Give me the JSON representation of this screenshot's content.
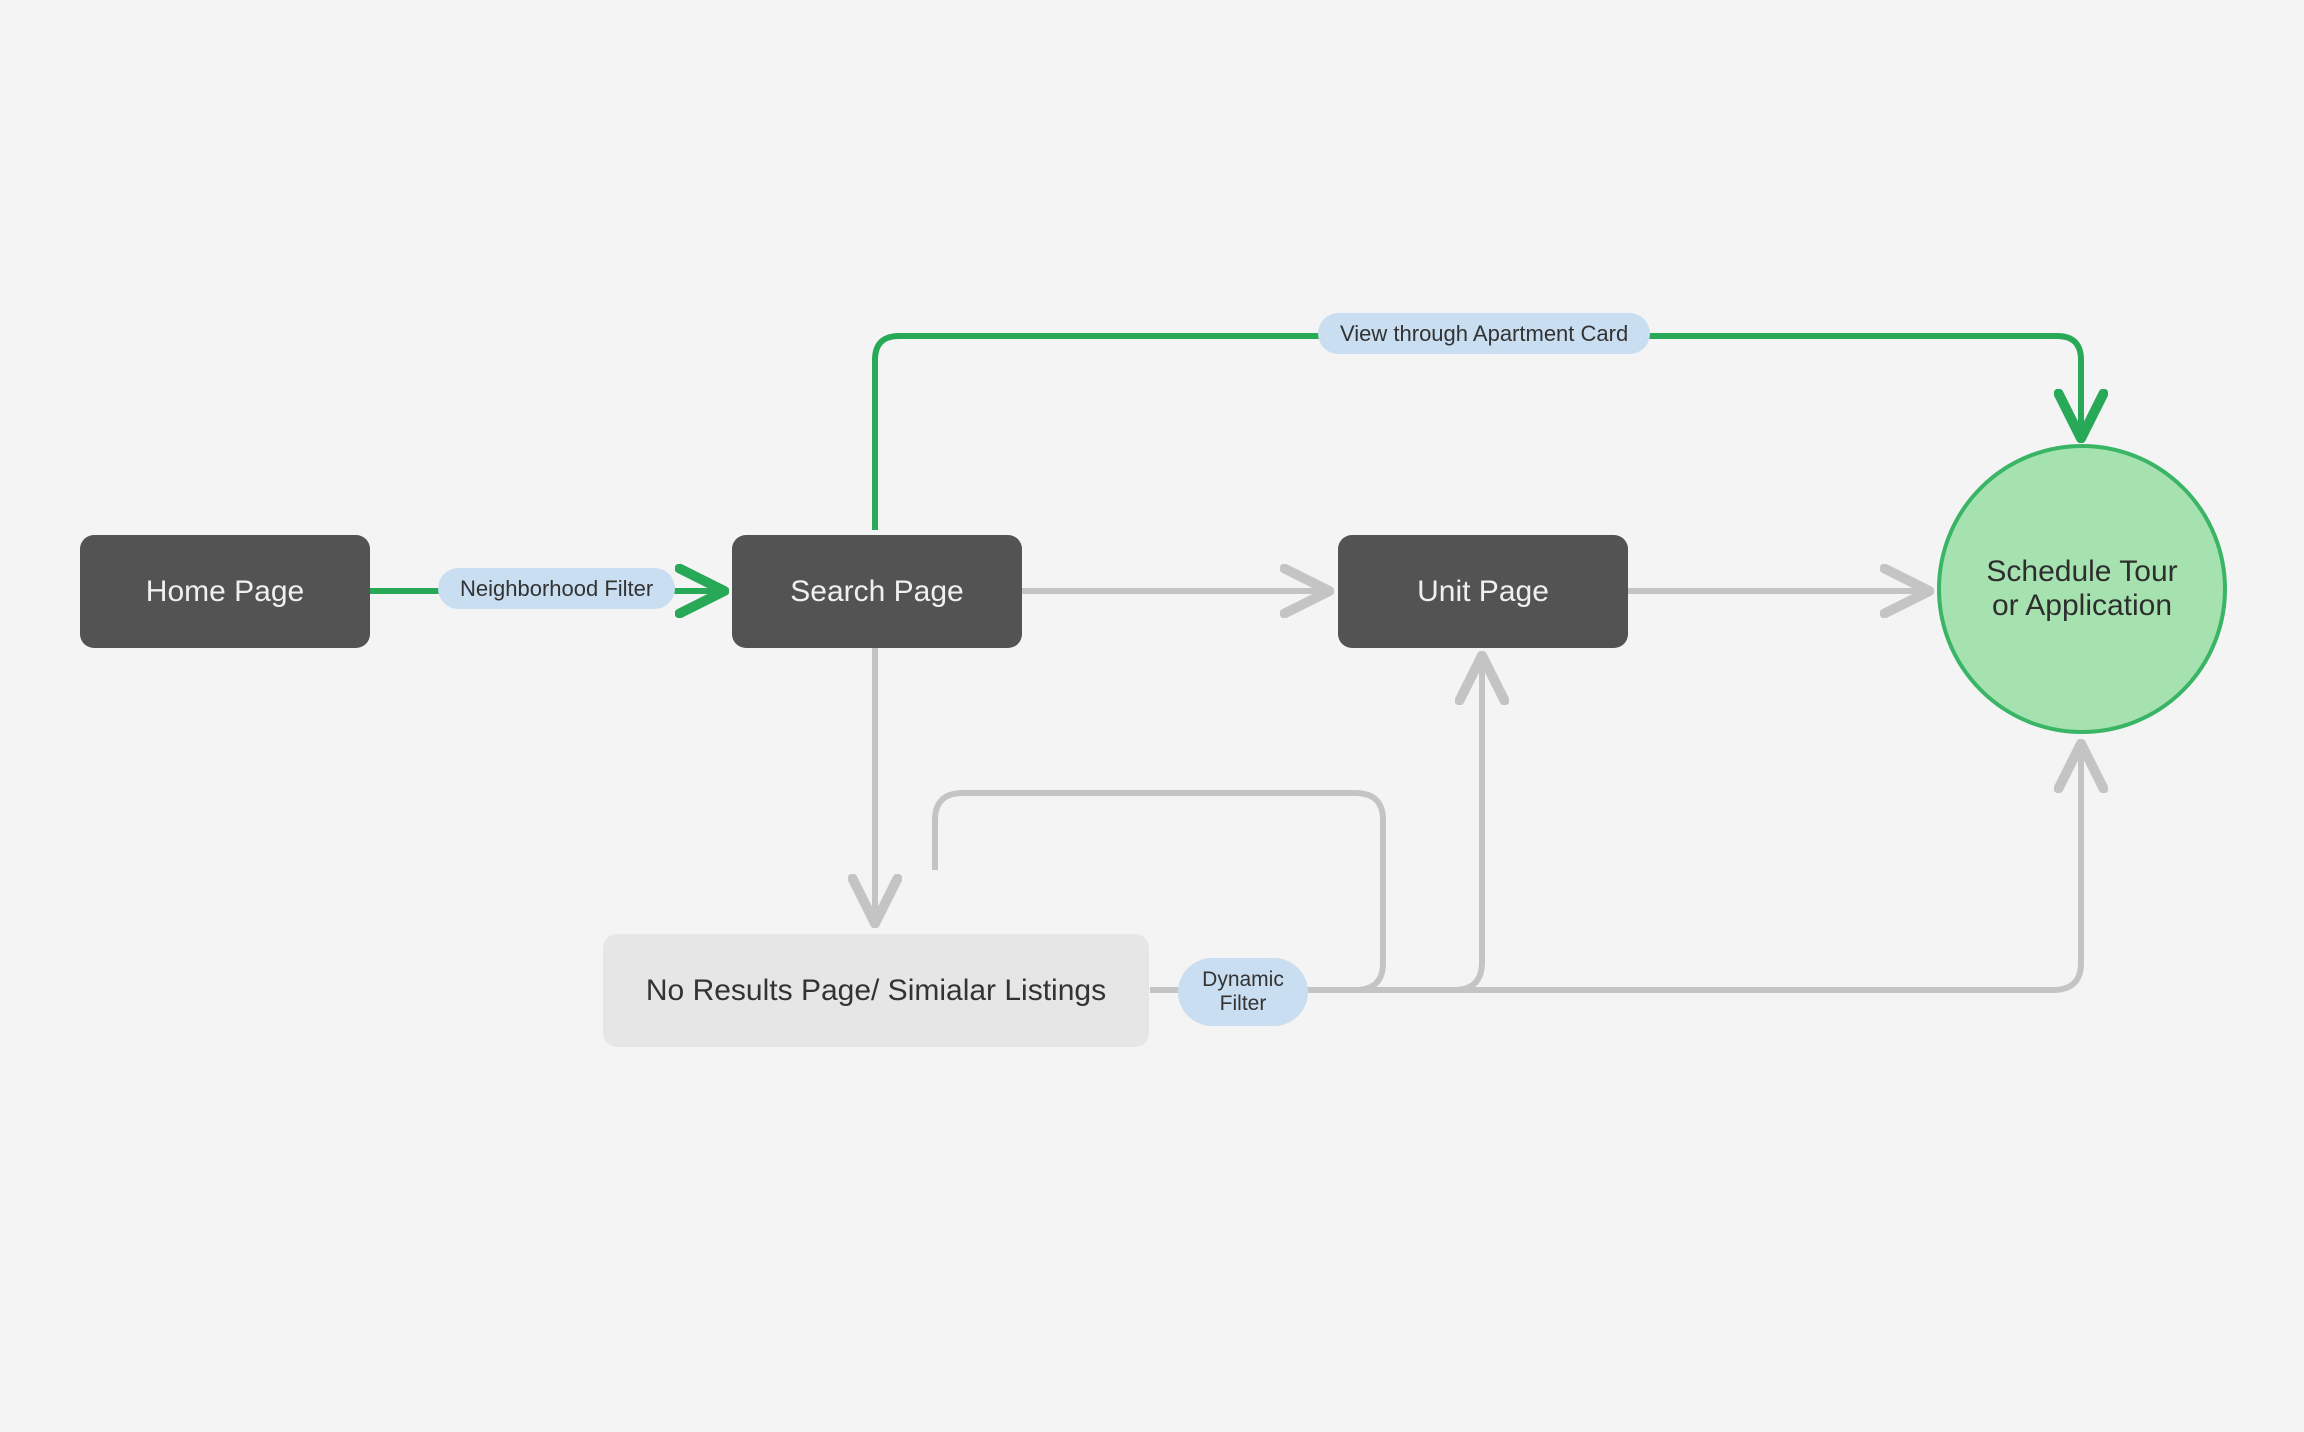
{
  "nodes": {
    "home": "Home Page",
    "search": "Search Page",
    "unit": "Unit Page",
    "noResults": "No Results Page/ Simialar Listings",
    "goal": "Schedule Tour or Application"
  },
  "edgeLabels": {
    "neighborhoodFilter": "Neighborhood Filter",
    "viewApartmentCard": "View through Apartment Card",
    "dynamicFilter": "Dynamic Filter"
  },
  "colors": {
    "green": "#27a957",
    "gray": "#c4c4c4",
    "nodeDark": "#535353",
    "nodeLight": "#e6e6e6",
    "pillBlue": "#c9def0",
    "goalFill": "#a6e2b0",
    "goalStroke": "#39b565",
    "bg": "#f4f4f4"
  }
}
